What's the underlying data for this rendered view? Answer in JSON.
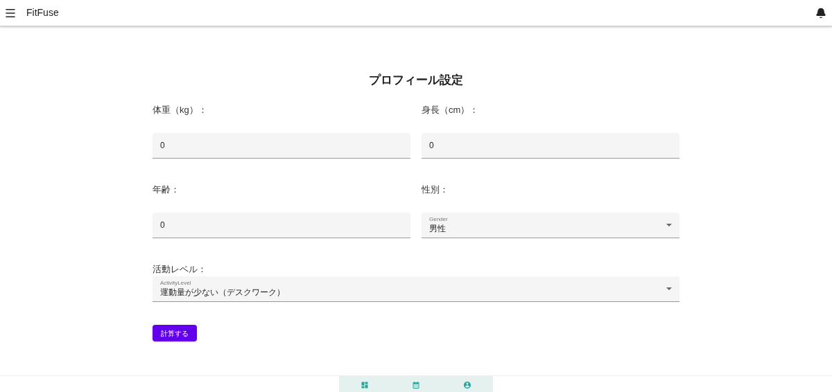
{
  "app_bar": {
    "title": "FitFuse"
  },
  "form": {
    "title": "プロフィール設定",
    "fields": [
      {
        "kind": "input",
        "label": "体重（kg）：",
        "value": "0"
      },
      {
        "kind": "input",
        "label": "身長（cm）：",
        "value": "0"
      },
      {
        "kind": "input",
        "label": "年齢：",
        "value": "0"
      },
      {
        "kind": "select",
        "label": "性別：",
        "select_label": "Gender",
        "value": "男性"
      },
      {
        "kind": "select",
        "label": "活動レベル：",
        "select_label": "ActivityLevel",
        "value": "運動量が少ない（デスクワーク）"
      }
    ],
    "submit": "計算する"
  },
  "bottom_nav": [
    {
      "kind": "dashboard"
    },
    {
      "kind": "calendar"
    },
    {
      "kind": "profile"
    }
  ]
}
